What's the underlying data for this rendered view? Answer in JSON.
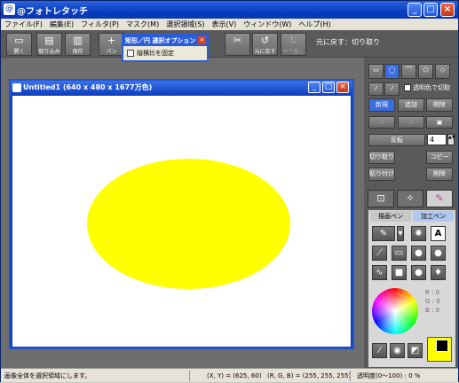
{
  "app": {
    "title": "@フォトレタッチ"
  },
  "menu": [
    "ファイル(F)",
    "編集(E)",
    "フィルタ(P)",
    "マスク(M)",
    "選択領域(S)",
    "表示(V)",
    "ウィンドウ(W)",
    "ヘルプ(H)"
  ],
  "toolbar": {
    "buttons": [
      {
        "label": "開く",
        "icon": "open-icon"
      },
      {
        "label": "取り込み",
        "icon": "import-icon"
      },
      {
        "label": "保存",
        "icon": "save-icon"
      },
      {
        "label": "パン",
        "icon": "pan-icon"
      },
      {
        "label": "元に戻す",
        "icon": "undo-icon"
      },
      {
        "label": "やり直し",
        "icon": "redo-icon"
      }
    ],
    "undo_text": "元に戻す：切り取り"
  },
  "popup": {
    "title": "矩形／円 選択オプション",
    "checkbox_label": "縦横比を固定"
  },
  "document": {
    "title": "Untitled1 (640 x 480 x 1677万色)",
    "shape_color": "#ffff00"
  },
  "panel": {
    "transparent_label": "透明色で切取",
    "new_label": "新規",
    "add_label": "追加",
    "remove_label": "削除",
    "invert_label": "反転",
    "stepper_value": "4",
    "cut_label": "切り取り",
    "copy_label": "コピー",
    "paste_label": "貼り付け",
    "delete_label": "削除"
  },
  "paint": {
    "tab_draw": "描画ペン",
    "tab_process": "加工ペン",
    "rgb": [
      "R : 0",
      "G : 0",
      "B : 0"
    ],
    "fg_color": "#000000",
    "bg_color": "#ffff00"
  },
  "status": {
    "message": "画像全体を選択領域にします。",
    "coords": "(X, Y) = (625, 60)",
    "rgb": "(R, G, B) = (255, 255, 255)",
    "opacity": "透明度(0～100) : 0 %"
  },
  "colors": {
    "accent": "#2a5ed8",
    "selection_active": "#3a6ee0"
  }
}
